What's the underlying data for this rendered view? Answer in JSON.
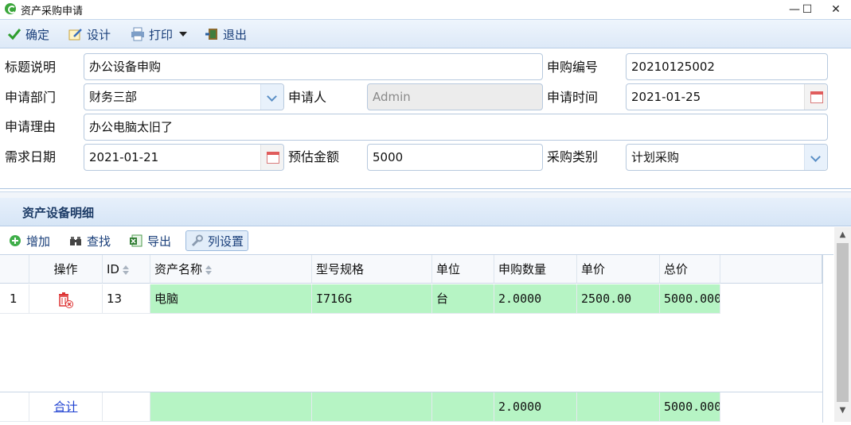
{
  "window": {
    "title": "资产采购申请",
    "controls": {
      "minimize": "—",
      "maximize": "☐",
      "close": "✕"
    }
  },
  "toolbar": {
    "confirm": "确定",
    "design": "设计",
    "print": "打印",
    "exit": "退出"
  },
  "form": {
    "title_label": "标题说明",
    "title_value": "办公设备申购",
    "code_label": "申购编号",
    "code_value": "20210125002",
    "dept_label": "申请部门",
    "dept_value": "财务三部",
    "applicant_label": "申请人",
    "applicant_value": "Admin",
    "apply_time_label": "申请时间",
    "apply_time_value": "2021-01-25",
    "reason_label": "申请理由",
    "reason_value": "办公电脑太旧了",
    "need_date_label": "需求日期",
    "need_date_value": "2021-01-21",
    "amount_label": "预估金额",
    "amount_value": "5000",
    "type_label": "采购类别",
    "type_value": "计划采购"
  },
  "detail": {
    "title": "资产设备明细",
    "toolbar": {
      "add": "增加",
      "find": "查找",
      "export": "导出",
      "columns": "列设置"
    },
    "columns": [
      "操作",
      "ID",
      "资产名称",
      "型号规格",
      "单位",
      "申购数量",
      "单价",
      "总价"
    ],
    "rows": [
      {
        "index": "1",
        "id": "13",
        "name": "电脑",
        "model": "I716G",
        "unit": "台",
        "qty": "2.0000",
        "price": "2500.00",
        "total": "5000.000"
      }
    ],
    "footer": {
      "label": "合计",
      "qty": "2.0000",
      "total": "5000.000"
    }
  },
  "colors": {
    "highlight": "#b6f4c4",
    "accent": "#1a3f7a"
  }
}
